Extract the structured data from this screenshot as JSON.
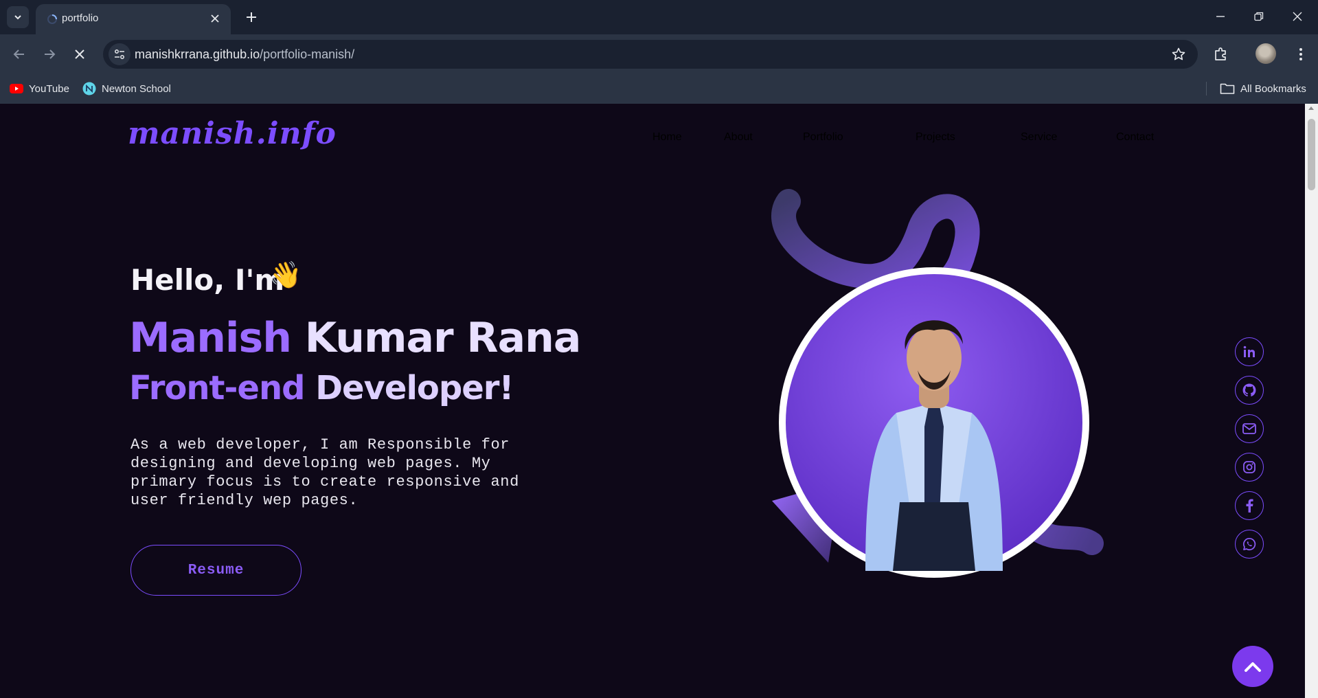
{
  "browser": {
    "tab": {
      "title": "portfolio"
    },
    "url": {
      "host": "manishkrrana.github.io",
      "path": "/portfolio-manish/"
    },
    "bookmarks": [
      {
        "label": "YouTube",
        "icon": "youtube-icon"
      },
      {
        "label": "Newton School",
        "icon": "newton-school-icon"
      }
    ],
    "all_bookmarks_label": "All Bookmarks"
  },
  "page": {
    "logo": "manish.info",
    "nav": [
      "Home",
      "About",
      "Portfolio",
      "Projects",
      "Service",
      "Contact"
    ],
    "hero": {
      "greeting": "Hello, I'm",
      "greeting_emoji": "👋",
      "name_first": "Manish",
      "name_rest": " Kumar Rana",
      "role_a": "Front-end",
      "role_b": " Developer!",
      "description": "As a web developer, I am Responsible for designing and developing web pages. My primary focus is to create responsive and user friendly wep pages.",
      "resume_label": "Resume"
    },
    "social_icons": [
      "linkedin-icon",
      "github-icon",
      "mail-icon",
      "instagram-icon",
      "facebook-icon",
      "whatsapp-icon"
    ],
    "colors": {
      "accent": "#7c4dff",
      "background": "#0e0818",
      "light_purple": "#ddd0ff"
    }
  }
}
